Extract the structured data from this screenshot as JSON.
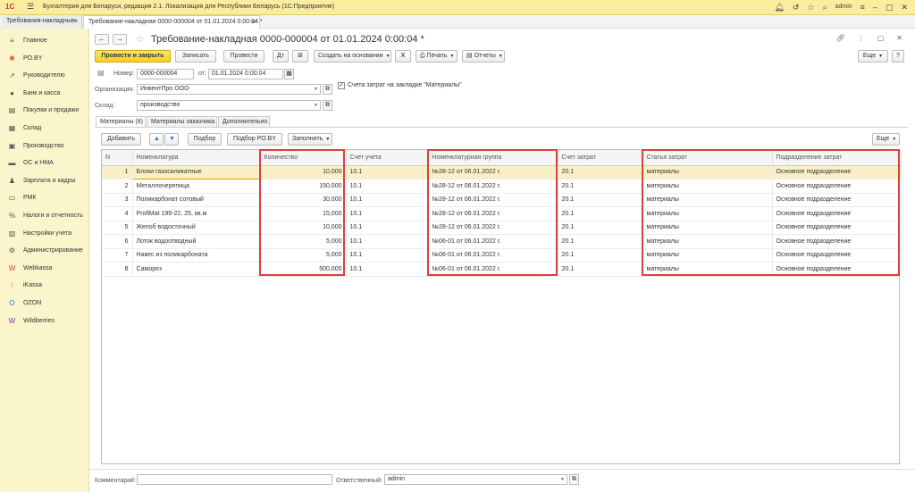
{
  "app": {
    "logo": "1С",
    "title": "Бухгалтерия для Беларуси, редакция 2.1. Локализация для Республики Беларусь   (1С:Предприятие)",
    "user": "admin"
  },
  "open_tabs": [
    {
      "label": "Требования-накладные"
    },
    {
      "label": "Требование-накладная 0000-000004 от 01.01.2024 0:00:04 *"
    }
  ],
  "sidebar": {
    "items": [
      {
        "label": "Главное",
        "icon": "≡",
        "color": "#555"
      },
      {
        "label": "PO.BY",
        "icon": "✱",
        "color": "#e05a2b"
      },
      {
        "label": "Руководителю",
        "icon": "↗",
        "color": "#555"
      },
      {
        "label": "Банк и касса",
        "icon": "●",
        "color": "#555"
      },
      {
        "label": "Покупки и продажи",
        "icon": "▤",
        "color": "#555"
      },
      {
        "label": "Склад",
        "icon": "▦",
        "color": "#555"
      },
      {
        "label": "Производство",
        "icon": "▣",
        "color": "#555"
      },
      {
        "label": "ОС и НМА",
        "icon": "▬",
        "color": "#555"
      },
      {
        "label": "Зарплата и кадры",
        "icon": "♟",
        "color": "#555"
      },
      {
        "label": "РМК",
        "icon": "▭",
        "color": "#555"
      },
      {
        "label": "Налоги и отчетность",
        "icon": "%",
        "color": "#555"
      },
      {
        "label": "Настройки учета",
        "icon": "▥",
        "color": "#555"
      },
      {
        "label": "Администрирование",
        "icon": "⚙",
        "color": "#555"
      },
      {
        "label": "Webkassa",
        "icon": "W",
        "color": "#d9413a"
      },
      {
        "label": "iKassa",
        "icon": "i",
        "color": "#e8a21a"
      },
      {
        "label": "OZON",
        "icon": "O",
        "color": "#2b6fd6"
      },
      {
        "label": "Wildberries",
        "icon": "W",
        "color": "#8b2fa0"
      }
    ]
  },
  "form": {
    "title": "Требование-накладная 0000-000004 от 01.01.2024 0:00:04 *",
    "toolbar": {
      "post_close": "Провести и закрыть",
      "save": "Записать",
      "post": "Провести",
      "create_based": "Создать на основании",
      "print": "Печать",
      "reports": "Отчеты",
      "more": "Еще"
    },
    "number_label": "Номер:",
    "number_value": "0000-000004",
    "date_label": "от:",
    "date_value": "01.01.2024  0:00:04",
    "org_label": "Организация:",
    "org_value": "ИнвентПро ООО",
    "cost_accounts_label": "Счета затрат на закладке \"Материалы\"",
    "warehouse_label": "Склад:",
    "warehouse_value": "производство",
    "tabs": [
      "Материалы (8)",
      "Материалы заказчика",
      "Дополнительно"
    ],
    "table_toolbar": {
      "add": "Добавить",
      "pick": "Подбор",
      "pick_poby": "Подбор PO.BY",
      "fill": "Заполнить",
      "more": "Еще"
    },
    "columns": [
      "N",
      "Номенклатура",
      "Количество",
      "Счет учета",
      "Номенклатурная группа",
      "Счет затрат",
      "Статья затрат",
      "Подразделение затрат"
    ],
    "rows": [
      {
        "n": "1",
        "item": "Блоки газосиликатные",
        "qty": "10,000",
        "account": "10.1",
        "group": "№28-12 от 06.01.2022 г.",
        "cost_account": "20.1",
        "cost_item": "материалы",
        "division": "Основное подразделение"
      },
      {
        "n": "2",
        "item": "Металлочерепица",
        "qty": "150,000",
        "account": "10.1",
        "group": "№28-12 от 06.01.2022 г.",
        "cost_account": "20.1",
        "cost_item": "материалы",
        "division": "Основное подразделение"
      },
      {
        "n": "3",
        "item": "Поликарбонат сотовый",
        "qty": "30,000",
        "account": "10.1",
        "group": "№28-12 от 06.01.2022 г.",
        "cost_account": "20.1",
        "cost_item": "материалы",
        "division": "Основное подразделение"
      },
      {
        "n": "4",
        "item": "ProfiMat 199-22, 25, кв.м",
        "qty": "15,000",
        "account": "10.1",
        "group": "№28-12 от 06.01.2022 г.",
        "cost_account": "20.1",
        "cost_item": "материалы",
        "division": "Основное подразделение"
      },
      {
        "n": "5",
        "item": "Желоб водосточный",
        "qty": "10,000",
        "account": "10.1",
        "group": "№28-12 от 06.01.2022 г.",
        "cost_account": "20.1",
        "cost_item": "материалы",
        "division": "Основное подразделение"
      },
      {
        "n": "6",
        "item": "Лоток водоотводный",
        "qty": "5,000",
        "account": "10.1",
        "group": "№06-01 от 06.01.2022 г.",
        "cost_account": "20.1",
        "cost_item": "материалы",
        "division": "Основное подразделение"
      },
      {
        "n": "7",
        "item": "Навес из поликарбоната",
        "qty": "5,000",
        "account": "10.1",
        "group": "№06-01 от 06.01.2022 г.",
        "cost_account": "20.1",
        "cost_item": "материалы",
        "division": "Основное подразделение"
      },
      {
        "n": "8",
        "item": "Саморез",
        "qty": "500,000",
        "account": "10.1",
        "group": "№06-01 от 06.01.2022 г.",
        "cost_account": "20.1",
        "cost_item": "материалы",
        "division": "Основное подразделение"
      }
    ],
    "comment_label": "Комментарий:",
    "comment_value": "",
    "responsible_label": "Ответственный:",
    "responsible_value": "admin"
  },
  "colors": {
    "highlight": "#d9413a",
    "selected_row": "#fbf0c5",
    "accent": "#f5cf2a",
    "sidebar_bg": "#fbf5cb"
  }
}
